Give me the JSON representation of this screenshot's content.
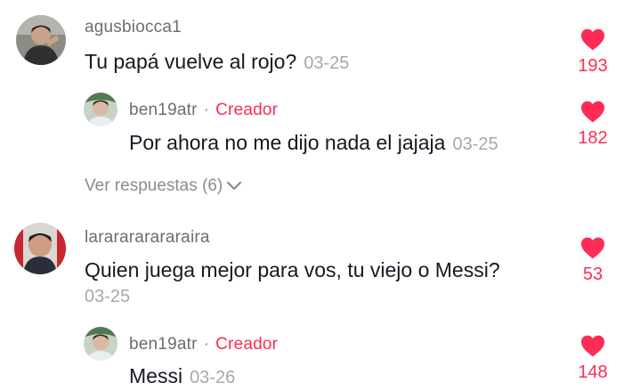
{
  "colors": {
    "accent": "#fe2c55",
    "muted": "#8a8b91",
    "text": "#161823"
  },
  "comments": [
    {
      "user": "agusbiocca1",
      "text": "Tu papá vuelve al rojo?",
      "date": "03-25",
      "likes": "193",
      "reply": {
        "user": "ben19atr",
        "badge": "Creador",
        "separator": "·",
        "text": "Por ahora no me dijo nada el jajaja",
        "date": "03-25",
        "likes": "182"
      },
      "more_replies": "Ver respuestas (6)"
    },
    {
      "user": "lararararararaira",
      "text": "Quien juega mejor para vos, tu viejo o Messi?",
      "date": "03-25",
      "likes": "53",
      "reply": {
        "user": "ben19atr",
        "badge": "Creador",
        "separator": "·",
        "text": "Messi",
        "date": "03-26",
        "likes": "148"
      }
    }
  ],
  "icons": {
    "like": "heart-icon",
    "expand": "chevron-down-icon"
  }
}
